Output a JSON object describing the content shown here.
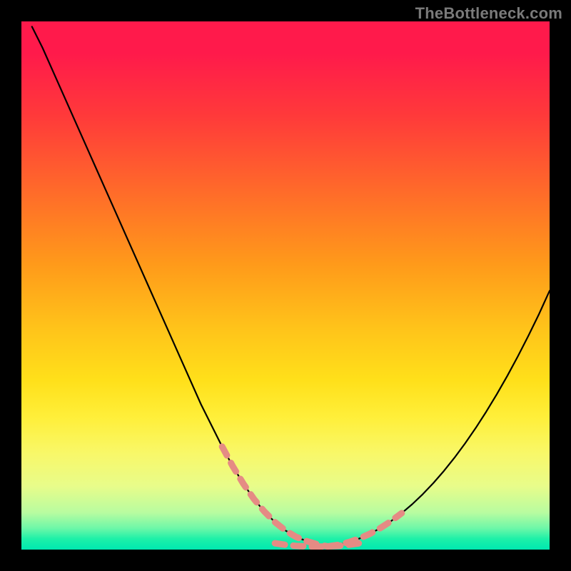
{
  "watermark": {
    "text": "TheBottleneck.com"
  },
  "chart_data": {
    "type": "line",
    "title": "",
    "xlabel": "",
    "ylabel": "",
    "xlim": [
      0,
      100
    ],
    "ylim": [
      0,
      100
    ],
    "grid": false,
    "legend": false,
    "series": [
      {
        "name": "left-curve",
        "style": "solid-black",
        "x": [
          2,
          4,
          6,
          8,
          10,
          12,
          14,
          16,
          18,
          20,
          22,
          24,
          26,
          28,
          30,
          32,
          34,
          36,
          38,
          40,
          42,
          44,
          46,
          48,
          50,
          52,
          54,
          56,
          58
        ],
        "y": [
          99,
          95,
          90.5,
          86,
          81.5,
          77,
          72.5,
          68,
          63.5,
          59,
          54.5,
          50,
          45.5,
          41,
          36.5,
          32,
          27.5,
          23.5,
          19.5,
          15.8,
          12.5,
          9.6,
          7.2,
          5.2,
          3.6,
          2.4,
          1.6,
          1.0,
          0.6
        ]
      },
      {
        "name": "right-curve",
        "style": "solid-black",
        "x": [
          58,
          60,
          62,
          64,
          66,
          68,
          70,
          72,
          74,
          76,
          78,
          80,
          82,
          84,
          86,
          88,
          90,
          92,
          94,
          96,
          98,
          100
        ],
        "y": [
          0.6,
          0.9,
          1.4,
          2.1,
          3.0,
          4.1,
          5.4,
          6.9,
          8.6,
          10.5,
          12.6,
          14.9,
          17.4,
          20.1,
          23.0,
          26.1,
          29.4,
          32.9,
          36.6,
          40.5,
          44.6,
          49.0
        ]
      },
      {
        "name": "left-dashed-highlight",
        "style": "dashed-salmon",
        "x": [
          38,
          40,
          42,
          44,
          46,
          48,
          50,
          52,
          54,
          56,
          58
        ],
        "y": [
          19.5,
          15.8,
          12.5,
          9.6,
          7.2,
          5.2,
          3.6,
          2.4,
          1.6,
          1.0,
          0.6
        ]
      },
      {
        "name": "right-dashed-highlight",
        "style": "dashed-salmon",
        "x": [
          58,
          60,
          62,
          64,
          66,
          68,
          70,
          72
        ],
        "y": [
          0.6,
          0.9,
          1.4,
          2.1,
          3.0,
          4.1,
          5.4,
          6.9
        ]
      },
      {
        "name": "bottom-dashed-highlight",
        "style": "dashed-salmon",
        "x": [
          48,
          50,
          52,
          54,
          56,
          58,
          60,
          62,
          64
        ],
        "y": [
          1.2,
          0.9,
          0.7,
          0.6,
          0.55,
          0.6,
          0.7,
          0.9,
          1.2
        ]
      }
    ],
    "colors": {
      "solid-black": "#000000",
      "dashed-salmon": "#e58b84"
    }
  }
}
